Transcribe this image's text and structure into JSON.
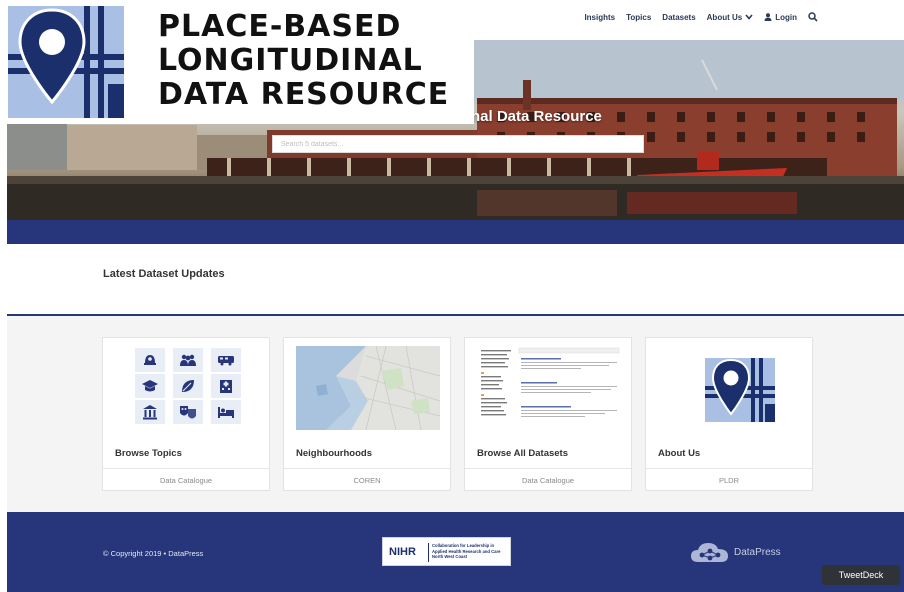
{
  "brand": {
    "title_lines": [
      "PLACE-BASED",
      "LONGITUDINAL",
      "DATA RESOURCE"
    ],
    "colors": {
      "navy": "#27367b",
      "logo_blue": "#1c2f6d",
      "logo_light": "#a9bfe3"
    }
  },
  "nav": {
    "items": [
      {
        "label": "Insights",
        "icon": null
      },
      {
        "label": "Topics",
        "icon": null
      },
      {
        "label": "Datasets",
        "icon": null
      },
      {
        "label": "About Us",
        "icon": "chevron-down-icon"
      },
      {
        "label": "Login",
        "icon": "user-icon"
      }
    ],
    "search_icon": "search-icon"
  },
  "hero": {
    "title_visible": "nal Data Resource",
    "search_placeholder": "Search 5 datasets..."
  },
  "latest": {
    "heading": "Latest Dataset Updates"
  },
  "cards": [
    {
      "title": "Browse Topics",
      "subtitle": "Data Catalogue",
      "thumb": "topic-icons"
    },
    {
      "title": "Neighbourhoods",
      "subtitle": "COREN",
      "thumb": "map"
    },
    {
      "title": "Browse All Datasets",
      "subtitle": "Data Catalogue",
      "thumb": "dataset-list"
    },
    {
      "title": "About Us",
      "subtitle": "PLDR",
      "thumb": "logo"
    }
  ],
  "topic_icons": [
    "police-icon",
    "people-icon",
    "bus-icon",
    "graduation-cap-icon",
    "leaf-icon",
    "hospital-icon",
    "bank-icon",
    "theatre-masks-icon",
    "bed-icon"
  ],
  "footer": {
    "copyright": "© Copyright 2019 • DataPress",
    "nihr": {
      "name": "NIHR",
      "tagline": "Collaboration for Leadership in Applied Health Research and Care North West Coast"
    },
    "datapress": "DataPress"
  },
  "tweetdeck": "TweetDeck"
}
